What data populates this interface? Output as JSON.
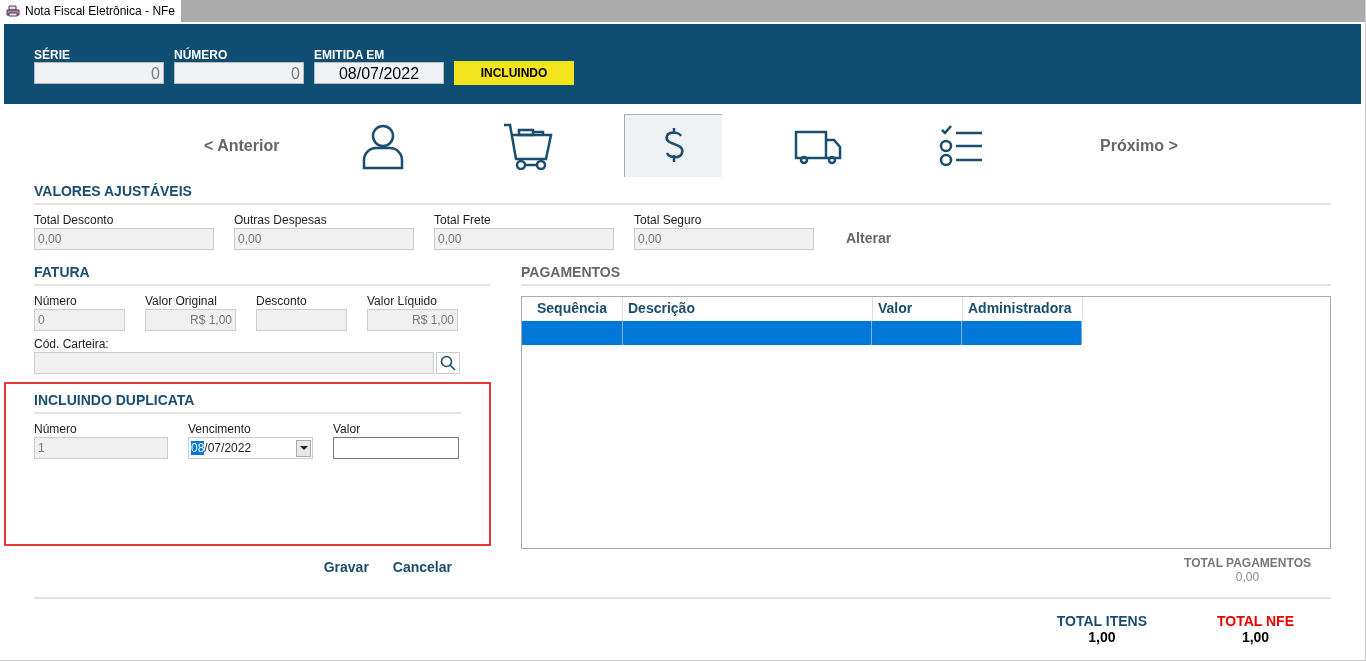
{
  "window": {
    "title": "Nota Fiscal Eletrônica - NFe"
  },
  "header": {
    "fields": [
      {
        "label": "SÉRIE",
        "value": "0",
        "kind": "readonly"
      },
      {
        "label": "NÚMERO",
        "value": "0",
        "kind": "readonly"
      },
      {
        "label": "EMITIDA EM",
        "value": "08/07/2022",
        "kind": "date"
      }
    ],
    "status": "INCLUINDO"
  },
  "nav": {
    "previous": "< Anterior",
    "next": "Próximo >",
    "steps": [
      {
        "kind": "person",
        "selected": false
      },
      {
        "kind": "cart",
        "selected": false
      },
      {
        "kind": "money",
        "selected": true
      },
      {
        "kind": "truck",
        "selected": false
      },
      {
        "kind": "checklist",
        "selected": false
      }
    ]
  },
  "valores_ajustaveis": {
    "title": "VALORES AJUSTÁVEIS",
    "fields": [
      {
        "label": "Total Desconto",
        "value": "0,00"
      },
      {
        "label": "Outras Despesas",
        "value": "0,00"
      },
      {
        "label": "Total Frete",
        "value": "0,00"
      },
      {
        "label": "Total Seguro",
        "value": "0,00"
      }
    ],
    "action": "Alterar"
  },
  "fatura": {
    "title": "FATURA",
    "fields": [
      {
        "label": "Número",
        "value": "0",
        "kind": "number"
      },
      {
        "label": "Valor Original",
        "value": "R$ 1,00",
        "kind": "money"
      },
      {
        "label": "Desconto",
        "kind": "number"
      },
      {
        "label": "Valor Líquido",
        "value": "R$ 1,00",
        "kind": "money"
      }
    ],
    "carteira": {
      "label": "Cód. Carteira:"
    }
  },
  "duplicata": {
    "title": "INCLUINDO DUPLICATA",
    "numero": {
      "label": "Número",
      "value": "1"
    },
    "vencimento": {
      "label": "Vencimento",
      "value": "08/07/2022",
      "day_selected": true
    },
    "valor": {
      "label": "Valor"
    }
  },
  "actions": [
    "Gravar",
    "Cancelar"
  ],
  "pagamentos": {
    "title": "PAGAMENTOS",
    "columns": [
      "Sequência",
      "Descrição",
      "Valor",
      "Administradora"
    ],
    "rows": [
      {
        "selected": true
      }
    ],
    "total_label": "TOTAL PAGAMENTOS",
    "total_value": "0,00"
  },
  "totals": [
    {
      "label": "TOTAL ITENS",
      "value": "1,00",
      "kind": "normal"
    },
    {
      "label": "TOTAL NFE",
      "value": "1,00",
      "kind": "alert"
    }
  ]
}
